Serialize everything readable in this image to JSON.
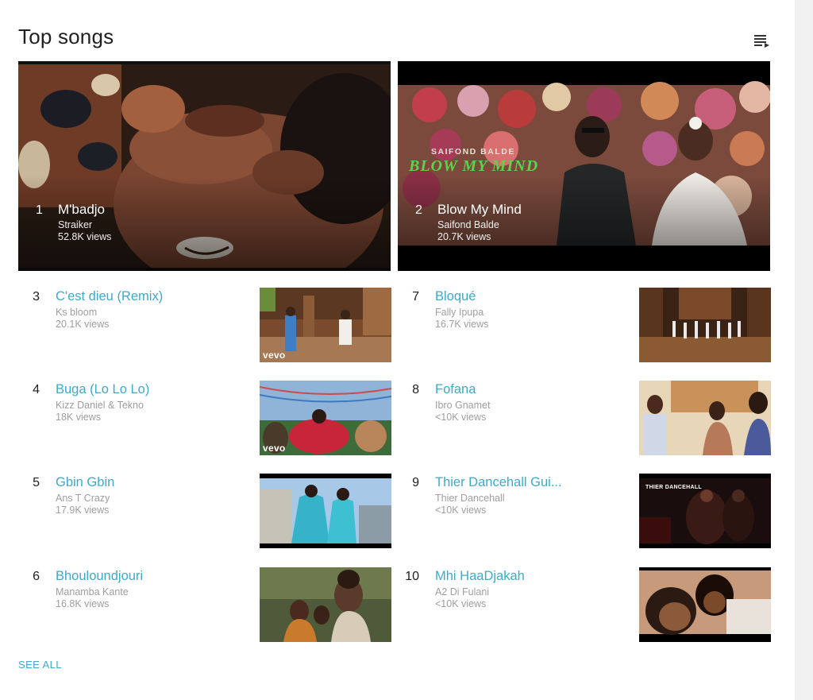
{
  "section": {
    "title": "Top songs",
    "see_all_label": "SEE ALL"
  },
  "featured": [
    {
      "rank": "1",
      "title": "M'badjo",
      "artist": "Straiker",
      "views": "52.8K views"
    },
    {
      "rank": "2",
      "title": "Blow My Mind",
      "artist": "Saifond Balde",
      "views": "20.7K views",
      "thumbnail_text": {
        "top": "SAIFOND BALDE",
        "bottom": "BLOW MY MIND"
      }
    }
  ],
  "songs_left": [
    {
      "rank": "3",
      "title": "C'est dieu (Remix)",
      "artist": "Ks bloom",
      "views": "20.1K views",
      "badge": "vevo"
    },
    {
      "rank": "4",
      "title": "Buga (Lo Lo Lo)",
      "artist": "Kizz Daniel & Tekno",
      "views": "18K views",
      "badge": "vevo"
    },
    {
      "rank": "5",
      "title": "Gbin Gbin",
      "artist": "Ans T Crazy",
      "views": "17.9K views"
    },
    {
      "rank": "6",
      "title": "Bhouloundjouri",
      "artist": "Manamba Kante",
      "views": "16.8K views"
    }
  ],
  "songs_right": [
    {
      "rank": "7",
      "title": "Bloqué",
      "artist": "Fally Ipupa",
      "views": "16.7K views"
    },
    {
      "rank": "8",
      "title": "Fofana",
      "artist": "Ibro Gnamet",
      "views": "<10K views"
    },
    {
      "rank": "9",
      "title": "Thier Dancehall Gui...",
      "artist": "Thier Dancehall",
      "views": "<10K views",
      "thumbnail_text": "THIER DANCEHALL"
    },
    {
      "rank": "10",
      "title": "Mhi HaaDjakah",
      "artist": "A2 Di Fulani",
      "views": "<10K views"
    }
  ],
  "colors": {
    "link": "#3fa9c7",
    "title": "#212121",
    "secondary": "#9e9e9e",
    "side_strip": "#f1f1f1"
  },
  "icons": {
    "queue": "playlist-queue-icon"
  }
}
